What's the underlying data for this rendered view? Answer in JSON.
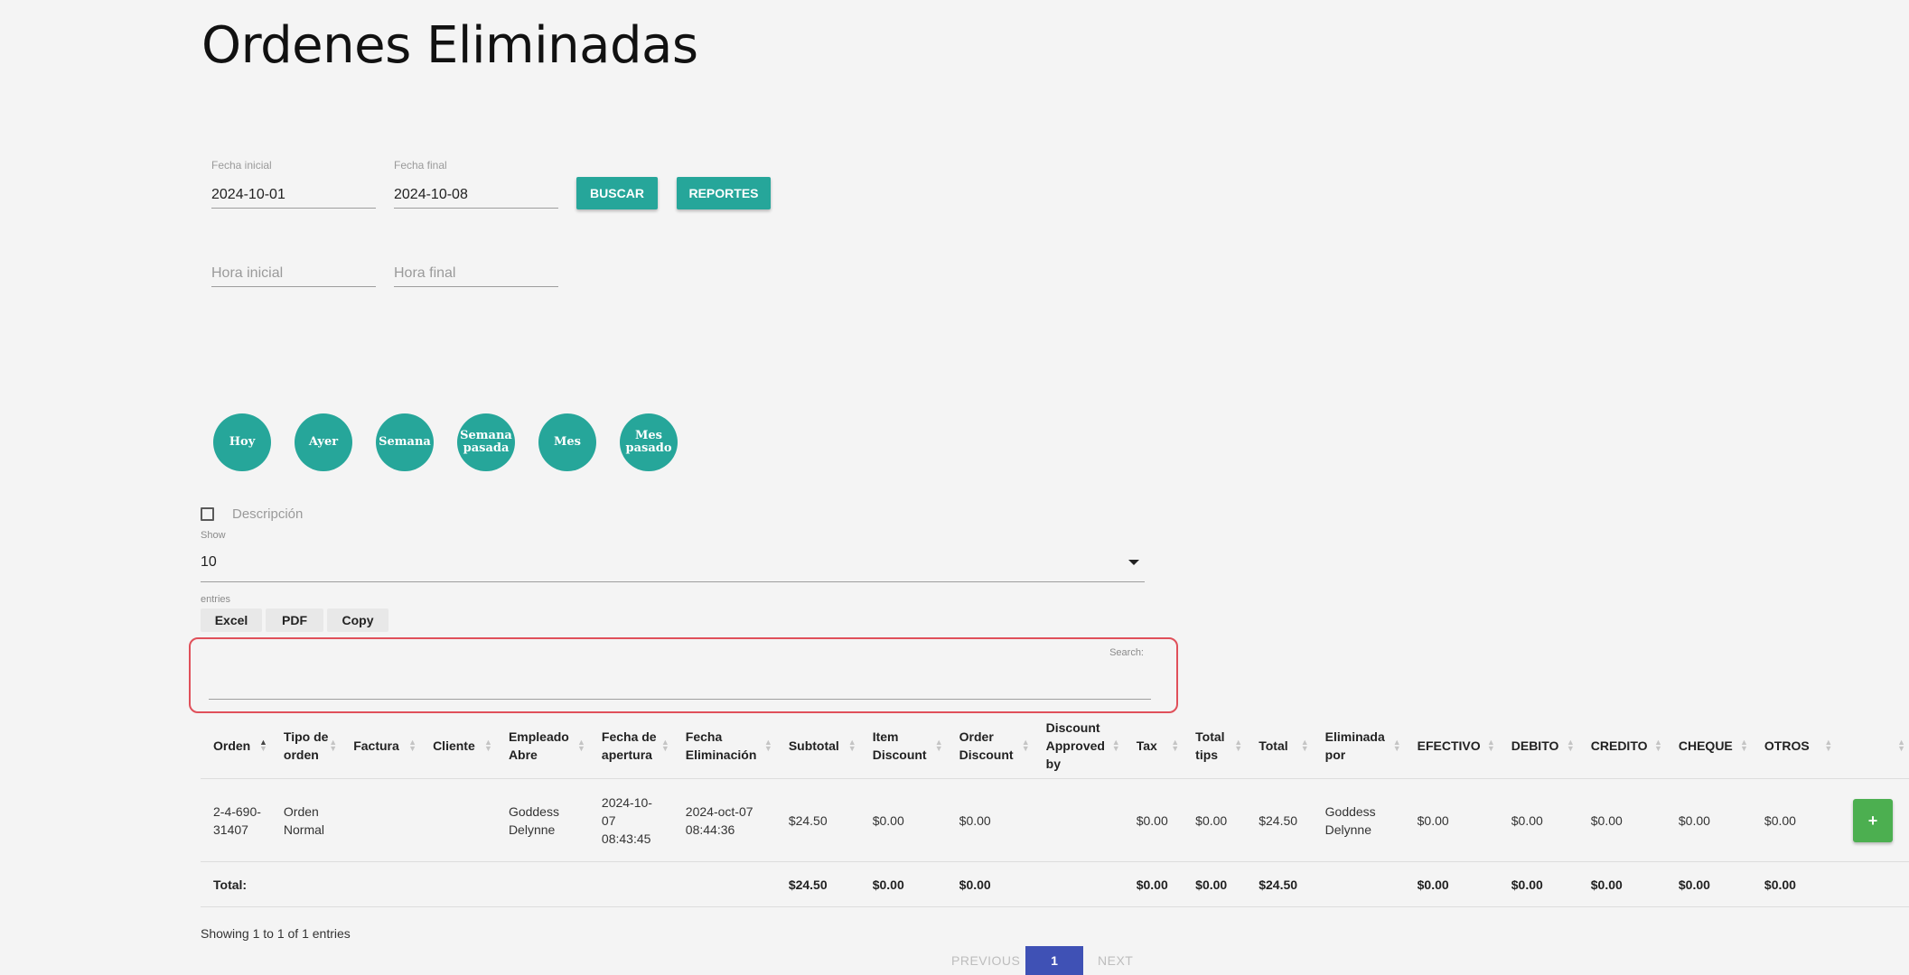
{
  "page_title": "Ordenes Eliminadas",
  "filters": {
    "fecha_inicial_label": "Fecha inicial",
    "fecha_inicial_value": "2024-10-01",
    "fecha_final_label": "Fecha final",
    "fecha_final_value": "2024-10-08",
    "hora_inicial_placeholder": "Hora inicial",
    "hora_final_placeholder": "Hora final",
    "buscar": "BUSCAR",
    "reportes": "REPORTES"
  },
  "quick_ranges": [
    {
      "label": "Hoy"
    },
    {
      "label": "Ayer"
    },
    {
      "label": "Semana"
    },
    {
      "label": "Semana pasada"
    },
    {
      "label": "Mes"
    },
    {
      "label": "Mes pasado"
    }
  ],
  "descripcion_label": "Descripción",
  "show_label": "Show",
  "show_value": "10",
  "entries_label": "entries",
  "export": {
    "excel": "Excel",
    "pdf": "PDF",
    "copy": "Copy"
  },
  "search_label": "Search:",
  "table": {
    "headers": [
      "Orden",
      "Tipo de orden",
      "Factura",
      "Cliente",
      "Empleado Abre",
      "Fecha de apertura",
      "Fecha Eliminación",
      "Subtotal",
      "Item Discount",
      "Order Discount",
      "Discount Approved by",
      "Tax",
      "Total tips",
      "Total",
      "Eliminada por",
      "EFECTIVO",
      "DEBITO",
      "CREDITO",
      "CHEQUE",
      "OTROS",
      ""
    ],
    "rows": [
      [
        "2-4-690-31407",
        "Orden Normal",
        "",
        "",
        "Goddess Delynne",
        "2024-10-07 08:43:45",
        "2024-oct-07 08:44:36",
        "$24.50",
        "$0.00",
        "$0.00",
        "",
        "$0.00",
        "$0.00",
        "$24.50",
        "Goddess Delynne",
        "$0.00",
        "$0.00",
        "$0.00",
        "$0.00",
        "$0.00",
        "+"
      ]
    ],
    "totals": [
      "Total:",
      "",
      "",
      "",
      "",
      "",
      "",
      "$24.50",
      "$0.00",
      "$0.00",
      "",
      "$0.00",
      "$0.00",
      "$24.50",
      "",
      "$0.00",
      "$0.00",
      "$0.00",
      "$0.00",
      "$0.00",
      ""
    ]
  },
  "showing_text": "Showing 1 to 1 of 1 entries",
  "pagination": {
    "previous": "PREVIOUS",
    "page": "1",
    "next": "NEXT"
  },
  "colors": {
    "teal": "#26a69a",
    "green": "#4caf50",
    "indigo": "#3f51b5",
    "highlight": "#e0505a"
  }
}
